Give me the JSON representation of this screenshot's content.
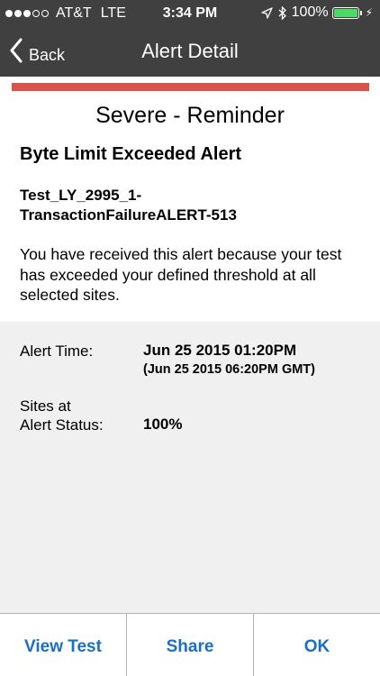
{
  "status_bar": {
    "carrier": "AT&T",
    "network": "LTE",
    "time": "3:34 PM",
    "battery": "100%",
    "signal_bars_full": 3,
    "signal_bars_total": 5,
    "battery_level": 1.0,
    "battery_color": "#4cd964"
  },
  "nav": {
    "back_label": "Back",
    "title": "Alert Detail",
    "bar_color": "#404040"
  },
  "alert": {
    "severity_color": "#d9534a",
    "severity_title": "Severe - Reminder",
    "name": "Byte Limit Exceeded Alert",
    "test_name_line1": "Test_LY_2995_1-",
    "test_name_line2": "TransactionFailureALERT-513",
    "message": "You have received this alert because your test has exceeded your defined threshold at all selected sites."
  },
  "details": {
    "alert_time_label": "Alert Time:",
    "alert_time_value": "Jun 25 2015 01:20PM",
    "alert_time_gmt": "(Jun 25 2015 06:20PM GMT)",
    "sites_label_line1": "Sites at",
    "sites_label_line2": "Alert Status:",
    "sites_value": "100%"
  },
  "toolbar": {
    "view_test_label": "View Test",
    "share_label": "Share",
    "ok_label": "OK",
    "accent_color": "#1a6fc4"
  }
}
